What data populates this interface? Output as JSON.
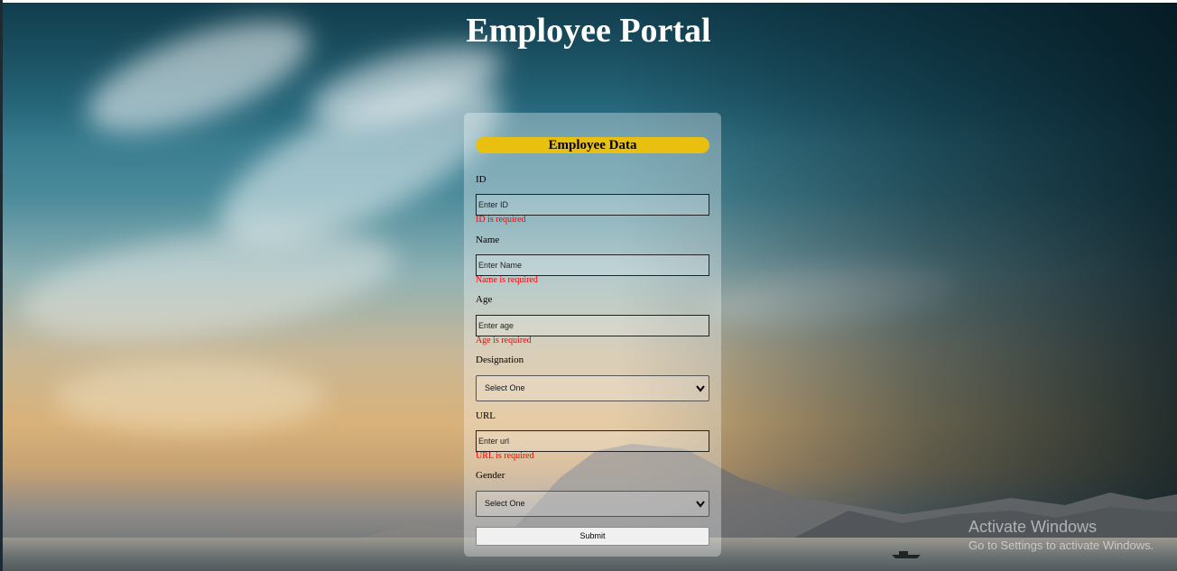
{
  "page": {
    "title": "Employee Portal"
  },
  "form": {
    "header": "Employee Data",
    "fields": {
      "id": {
        "label": "ID",
        "placeholder": "Enter ID",
        "error": "ID is required"
      },
      "name": {
        "label": "Name",
        "placeholder": "Enter Name",
        "error": "Name is required"
      },
      "age": {
        "label": "Age",
        "placeholder": "Enter age",
        "error": "Age is required"
      },
      "designation": {
        "label": "Designation",
        "selected": "Select One"
      },
      "url": {
        "label": "URL",
        "placeholder": "Enter url",
        "error": "URL is required"
      },
      "gender": {
        "label": "Gender",
        "selected": "Select One"
      }
    },
    "submit_label": "Submit"
  },
  "watermark": {
    "line1": "Activate Windows",
    "line2": "Go to Settings to activate Windows."
  },
  "colors": {
    "header_bg": "#e9c010",
    "error": "#ff0000",
    "title": "#ffffff"
  }
}
